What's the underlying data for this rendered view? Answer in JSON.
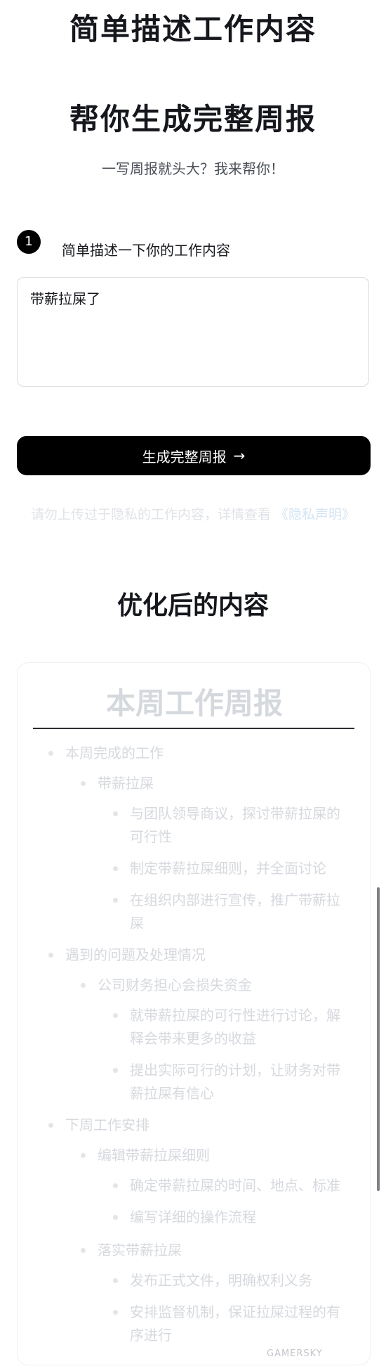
{
  "hero": {
    "line1": "简单描述工作内容",
    "line2": "帮你生成完整周报"
  },
  "subtitle": "一写周报就头大？我来帮你！",
  "step": {
    "number": "1",
    "label": "简单描述一下你的工作内容"
  },
  "input": {
    "value": "带薪拉屎了"
  },
  "generate_button": {
    "label": "生成完整周报",
    "arrow": "→"
  },
  "privacy": {
    "text": "请勿上传过于隐私的工作内容，详情查看",
    "link": "《隐私声明》"
  },
  "result": {
    "title": "优化后的内容"
  },
  "report": {
    "title": "本周工作周报",
    "sections": [
      {
        "label": "本周完成的工作",
        "items": [
          {
            "label": "带薪拉屎",
            "details": [
              "与团队领导商议，探讨带薪拉屎的可行性",
              "制定带薪拉屎细则，并全面讨论",
              "在组织内部进行宣传，推广带薪拉屎"
            ]
          }
        ]
      },
      {
        "label": "遇到的问题及处理情况",
        "items": [
          {
            "label": "公司财务担心会损失资金",
            "details": [
              "就带薪拉屎的可行性进行讨论，解释会带来更多的收益",
              "提出实际可行的计划，让财务对带薪拉屎有信心"
            ]
          }
        ]
      },
      {
        "label": "下周工作安排",
        "items": [
          {
            "label": "编辑带薪拉屎细则",
            "details": [
              "确定带薪拉屎的时间、地点、标准",
              "编写详细的操作流程"
            ]
          },
          {
            "label": "落实带薪拉屎",
            "details": [
              "发布正式文件，明确权利义务",
              "安排监督机制，保证拉屎过程的有序进行"
            ]
          }
        ]
      }
    ]
  },
  "watermark": "GAMERSKY"
}
